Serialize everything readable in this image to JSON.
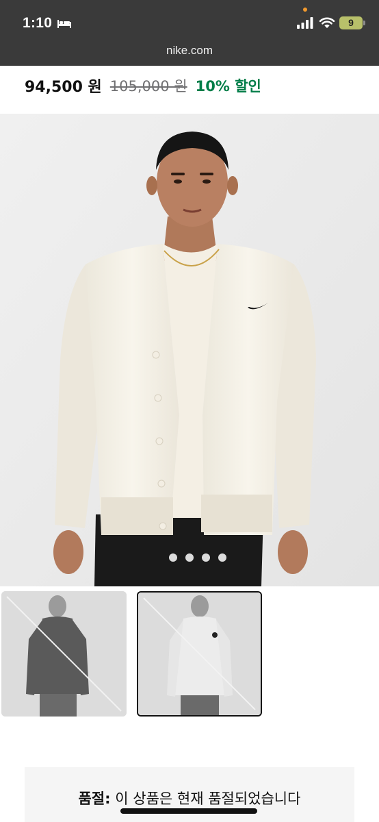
{
  "status_bar": {
    "time": "1:10",
    "battery": "9"
  },
  "browser": {
    "url": "nike.com"
  },
  "price": {
    "current": "94,500 원",
    "original": "105,000 원",
    "discount": "10% 할인"
  },
  "gallery": {
    "page_count": 4,
    "thumbnails": [
      {
        "name": "black-cardigan",
        "selected": false,
        "unavailable": true
      },
      {
        "name": "white-cardigan",
        "selected": true,
        "unavailable": true
      }
    ]
  },
  "sold_out": {
    "label": "품절:",
    "message": "이 상품은 현재 품절되었습니다"
  },
  "colors": {
    "accent_green": "#007d48",
    "strike_gray": "#707072"
  }
}
